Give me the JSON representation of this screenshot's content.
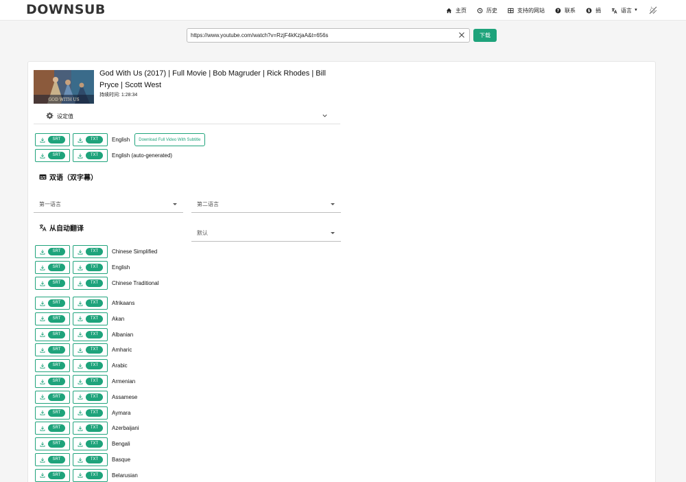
{
  "logo": "DOWNSUB",
  "nav": {
    "home": "主页",
    "history": "历史",
    "supported": "支持的网站",
    "contact": "联系",
    "donate": "捐",
    "language": "语言"
  },
  "search": {
    "url": "https://www.youtube.com/watch?v=RzjF4kKzjaA&t=656s",
    "button": "下载"
  },
  "video": {
    "title": "God With Us (2017) | Full Movie | Bob Magruder | Rick Rhodes | Bill Pryce | Scott West",
    "duration": "持续时间: 1:28:34",
    "thumb_text": "GOD WITH US"
  },
  "settings": {
    "label": "设定值"
  },
  "buttons": {
    "srt": "SRT",
    "txt": "TXT",
    "full_video": "Download Full Video With Subtitle"
  },
  "subtitles": [
    {
      "lang": "English"
    },
    {
      "lang": "English (auto-generated)"
    }
  ],
  "bilingual": {
    "title": "双语（双字幕）",
    "first": "第一语言",
    "second": "第二语言",
    "default": "默认"
  },
  "auto_translate": {
    "title": "从自动翻译",
    "top": [
      "Chinese Simplified",
      "English",
      "Chinese Traditional"
    ],
    "langs": [
      "Afrikaans",
      "Akan",
      "Albanian",
      "Amharic",
      "Arabic",
      "Armenian",
      "Assamese",
      "Aymara",
      "Azerbaijani",
      "Bengali",
      "Basque",
      "Belarusian"
    ]
  },
  "colors": {
    "accent": "#1ea37b"
  }
}
